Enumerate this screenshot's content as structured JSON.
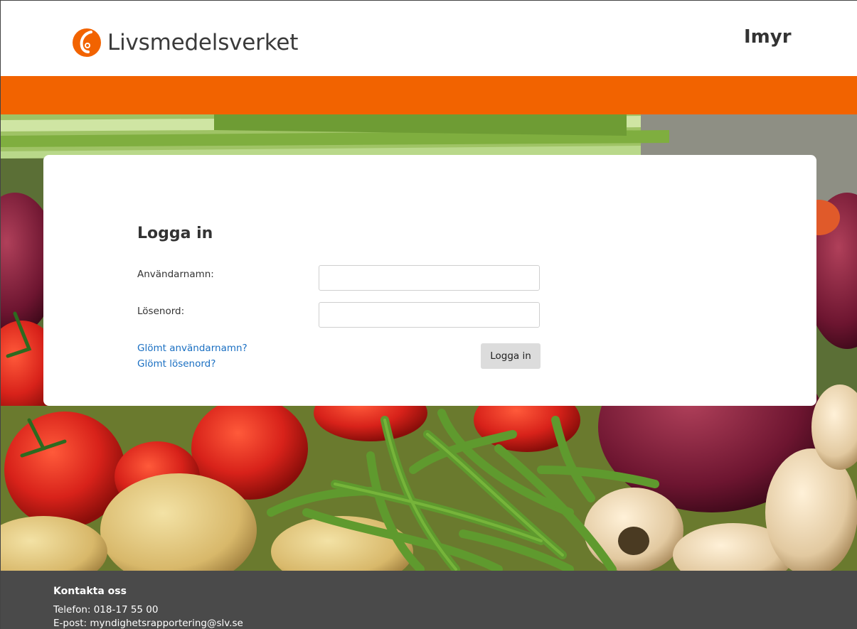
{
  "header": {
    "brand_name": "Livsmedelsverket",
    "app_name": "Imyr"
  },
  "colors": {
    "brand_orange": "#f26300",
    "footer_bg": "#4a4a4a",
    "link_blue": "#1a6fc2",
    "button_bg": "#dcdcdc"
  },
  "login": {
    "title": "Logga in",
    "username_label": "Användarnamn:",
    "username_value": "",
    "password_label": "Lösenord:",
    "password_value": "",
    "forgot_username": "Glömt användarnamn?",
    "forgot_password": "Glömt lösenord?",
    "submit_label": "Logga in"
  },
  "footer": {
    "title": "Kontakta oss",
    "phone": "Telefon: 018-17 55 00",
    "email": "E-post: myndighetsrapportering@slv.se"
  },
  "icons": {
    "logo": "livsmedelsverket-logo-icon"
  }
}
